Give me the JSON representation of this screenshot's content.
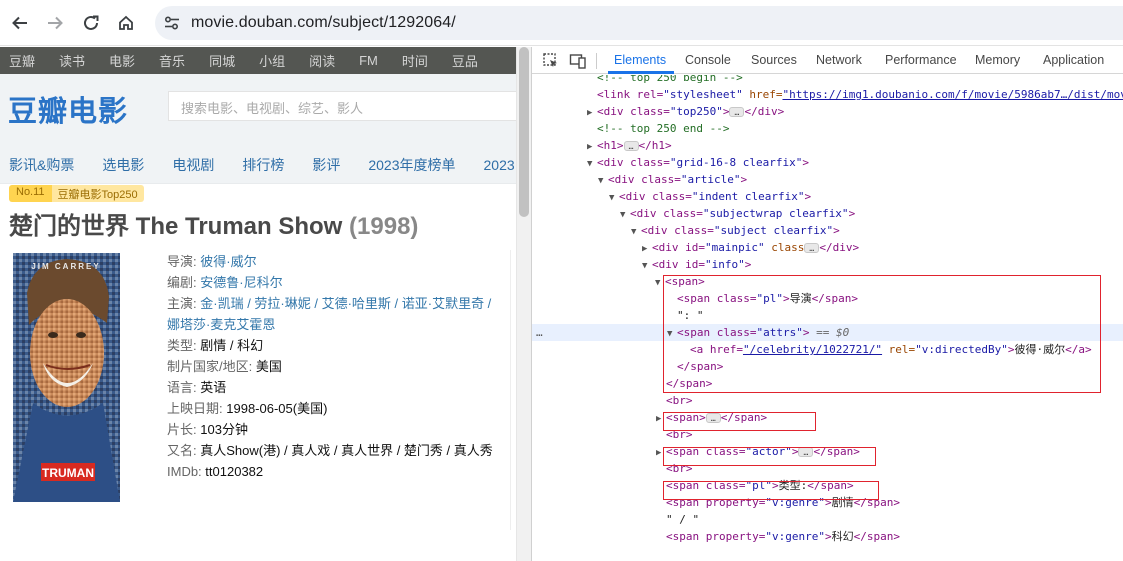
{
  "browser": {
    "url": "movie.douban.com/subject/1292064/"
  },
  "douban": {
    "global_nav": [
      "豆瓣",
      "读书",
      "电影",
      "音乐",
      "同城",
      "小组",
      "阅读",
      "FM",
      "时间",
      "豆品"
    ],
    "logo": "豆瓣电影",
    "search_placeholder": "搜索电影、电视剧、综艺、影人",
    "sub_nav": [
      "影讯&购票",
      "选电影",
      "电视剧",
      "排行榜",
      "影评",
      "2023年度榜单",
      "2023"
    ],
    "rank_no": "No.11",
    "rank_tag": "豆瓣电影Top250",
    "title": "楚门的世界 The Truman Show",
    "year": "(1998)",
    "poster": {
      "top_text": "JIM CARREY",
      "brand": "TRUMAN"
    },
    "info": {
      "director_label": "导演:",
      "director": "彼得·威尔",
      "writer_label": "编剧:",
      "writer": "安德鲁·尼科尔",
      "actors_label": "主演:",
      "actors_line1": "金·凯瑞 / 劳拉·琳妮 / 艾德·哈里斯 / 诺亚·艾默里奇 /",
      "actors_line2": "娜塔莎·麦克艾霍恩",
      "genre_label": "类型:",
      "genre": "剧情 / 科幻",
      "country_label": "制片国家/地区:",
      "country": "美国",
      "language_label": "语言:",
      "language": "英语",
      "release_label": "上映日期:",
      "release": "1998-06-05(美国)",
      "runtime_label": "片长:",
      "runtime": "103分钟",
      "aka_label": "又名:",
      "aka": "真人Show(港) / 真人戏 / 真人世界 / 楚门秀 / 真人秀",
      "imdb_label": "IMDb:",
      "imdb": "tt0120382"
    }
  },
  "devtools": {
    "tabs": [
      "Elements",
      "Console",
      "Sources",
      "Network",
      "Performance",
      "Memory",
      "Application"
    ],
    "active_tab": "Elements",
    "dom": {
      "l0": "<!-- top 250 begin -->",
      "l1_a": "<link rel=",
      "l1_b": "\"stylesheet\"",
      "l1_c": " href=",
      "l1_d": "\"https://img1.doubanio.com/f/movie/5986ab7…/dist/mov",
      "l2_a": "<div class=",
      "l2_b": "\"top250\"",
      "l2_c": "</div>",
      "l3": "<!-- top 250 end -->",
      "l4_a": "<h1>",
      "l4_b": "</h1>",
      "l5_a": "<div class=",
      "l5_b": "\"grid-16-8 clearfix\"",
      "l6_a": "<div class=",
      "l6_b": "\"article\"",
      "l7_a": "<div class=",
      "l7_b": "\"indent clearfix\"",
      "l8_a": "<div class=",
      "l8_b": "\"subjectwrap clearfix\"",
      "l9_a": "<div class=",
      "l9_b": "\"subject clearfix\"",
      "l10_a": "<div id=",
      "l10_b": "\"mainpic\"",
      "l10_c": " class",
      "l10_d": "</div>",
      "l11_a": "<div id=",
      "l11_b": "\"info\"",
      "l12": "<span>",
      "l13_a": "<span class=",
      "l13_b": "\"pl\"",
      "l13_c": "导演",
      "l13_d": "</span>",
      "l14": "\": \"",
      "l15_a": "<span class=",
      "l15_b": "\"attrs\"",
      "l15_c": " == $0",
      "l16_a": "<a href=",
      "l16_b": "\"/celebrity/1022721/\"",
      "l16_c": " rel=",
      "l16_d": "\"v:directedBy\"",
      "l16_e": "彼得·威尔",
      "l16_f": "</a>",
      "l17": "</span>",
      "l18": "</span>",
      "l19": "<br>",
      "l20_a": "<span>",
      "l20_b": "</span>",
      "l21": "<br>",
      "l22_a": "<span class=",
      "l22_b": "\"actor\"",
      "l22_c": "</span>",
      "l23": "<br>",
      "l24_a": "<span class=",
      "l24_b": "\"pl\"",
      "l24_c": "类型:",
      "l24_d": "</span>",
      "l25_a": "<span property=",
      "l25_b": "\"v:genre\"",
      "l25_c": "剧情",
      "l25_d": "</span>",
      "l26": "\" / \"",
      "l27_a": "<span property=",
      "l27_b": "\"v:genre\"",
      "l27_c": "科幻",
      "l27_d": "</span>",
      "ellipsis": "…",
      "gutter": "…"
    }
  },
  "colors": {
    "link": "#3377aa",
    "logo": "#2b74c7",
    "highlight_box": "#e0232e",
    "devtools_accent": "#1a73e8"
  }
}
